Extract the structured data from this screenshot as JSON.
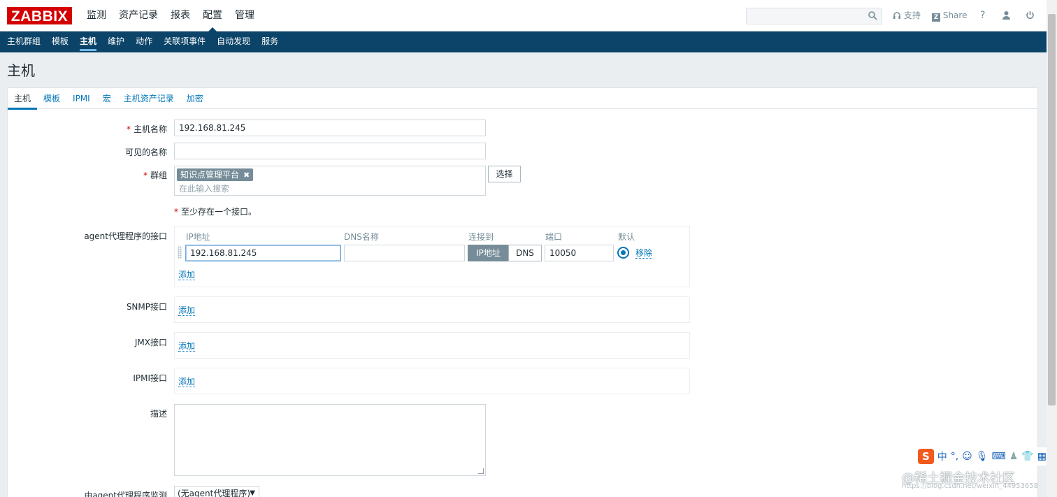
{
  "header": {
    "logo": "ZABBIX",
    "main_menu": [
      "监测",
      "资产记录",
      "报表",
      "配置",
      "管理"
    ],
    "active_main": "配置",
    "search_placeholder": "",
    "support": "支持",
    "share": "Share",
    "help": "?"
  },
  "submenu": {
    "items": [
      "主机群组",
      "模板",
      "主机",
      "维护",
      "动作",
      "关联项事件",
      "自动发现",
      "服务"
    ],
    "active": "主机"
  },
  "page_title": "主机",
  "tabs": {
    "items": [
      "主机",
      "模板",
      "IPMI",
      "宏",
      "主机资产记录",
      "加密"
    ],
    "active": "主机"
  },
  "form": {
    "host_name_label": "主机名称",
    "host_name_value": "192.168.81.245",
    "visible_name_label": "可见的名称",
    "visible_name_value": "",
    "groups_label": "群组",
    "group_chip": "知识点管理平台",
    "group_placeholder": "在此输入搜索",
    "select_button": "选择",
    "interface_hint": "至少存在一个接口。",
    "agent_label": "agent代理程序的接口",
    "col_ip": "IP地址",
    "col_dns": "DNS名称",
    "col_connect": "连接到",
    "col_port": "端口",
    "col_default": "默认",
    "agent_ip": "192.168.81.245",
    "agent_dns": "",
    "btn_ip": "IP地址",
    "btn_dns": "DNS",
    "agent_port": "10050",
    "remove": "移除",
    "add": "添加",
    "snmp_label": "SNMP接口",
    "jmx_label": "JMX接口",
    "ipmi_label": "IPMI接口",
    "description_label": "描述",
    "proxy_label": "由agent代理程序监测",
    "proxy_value": "(无agent代理程序)"
  },
  "ime": {
    "logo": "S",
    "mode": "中",
    "punct": "°,"
  },
  "watermark": "@稀土掘金技术社区",
  "watermark_small": "https://blog.csdn.net/weixin_44953658"
}
